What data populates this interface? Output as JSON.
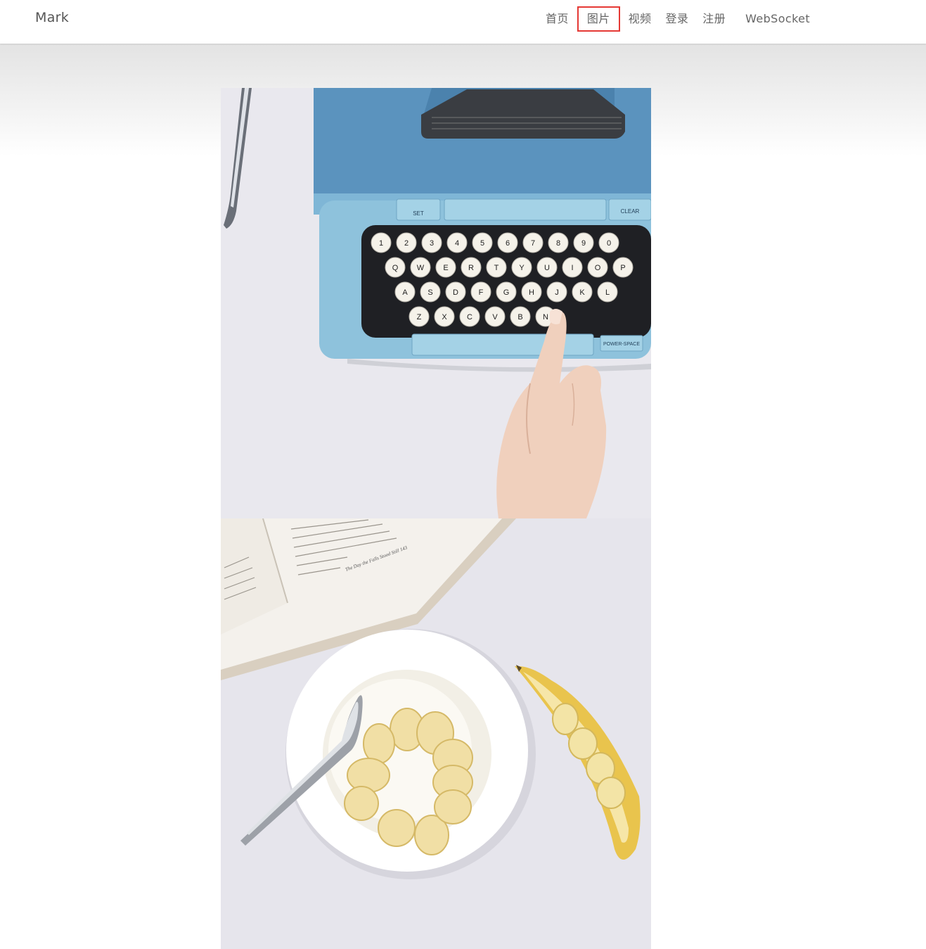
{
  "header": {
    "brand": "Mark",
    "nav": [
      {
        "label": "首页"
      },
      {
        "label": "图片",
        "highlighted": true
      },
      {
        "label": "视频"
      },
      {
        "label": "登录"
      },
      {
        "label": "注册"
      },
      {
        "label": "WebSocket"
      }
    ]
  },
  "gallery": {
    "photos": [
      {
        "subject": "blue typewriter",
        "key_labels": {
          "set": "SET",
          "clear": "CLEAR",
          "power_space": "POWER-SPACE",
          "row_numbers": [
            "1",
            "2",
            "3",
            "4",
            "5",
            "6",
            "7",
            "8",
            "9",
            "0"
          ],
          "row_top": [
            "Q",
            "W",
            "E",
            "R",
            "T",
            "Y",
            "U",
            "I",
            "O",
            "P"
          ],
          "row_mid": [
            "A",
            "S",
            "D",
            "F",
            "G",
            "H",
            "J",
            "K",
            "L"
          ],
          "row_bottom": [
            "Z",
            "X",
            "C",
            "V",
            "B",
            "N"
          ]
        }
      },
      {
        "subject": "yogurt with banana slices and open book",
        "book_header": "The Day the Falls Stood Still   143"
      }
    ]
  },
  "colors": {
    "highlight_border": "#e53935",
    "typewriter_blue": "#5b93be",
    "typewriter_light": "#8ec2dc"
  }
}
